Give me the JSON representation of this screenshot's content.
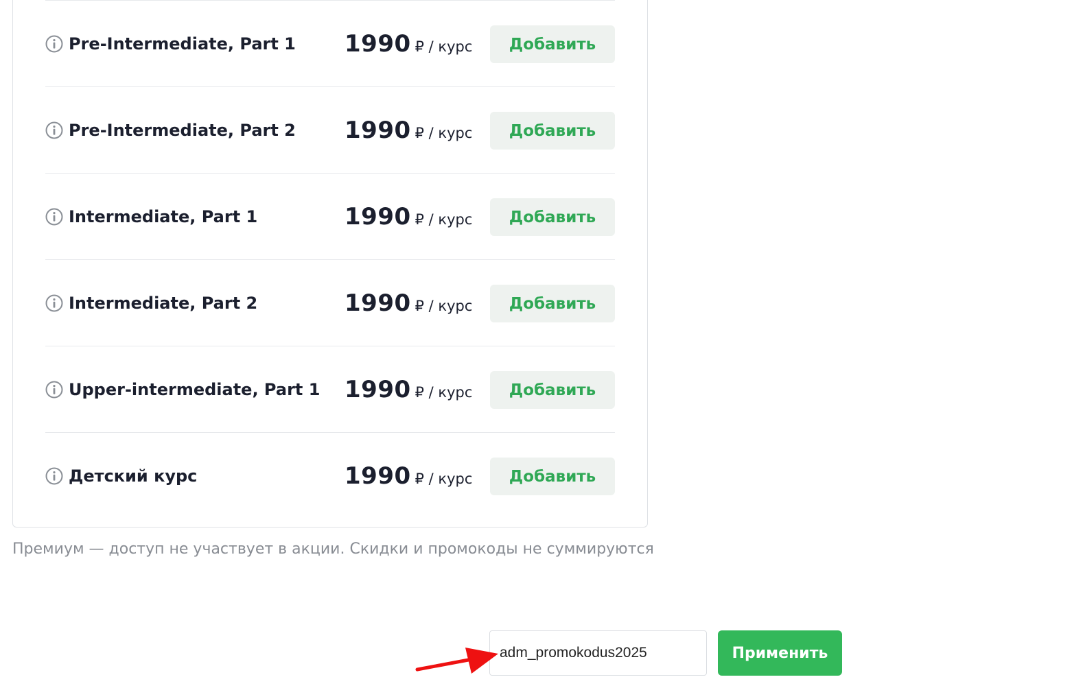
{
  "courses": [
    {
      "name": "Pre-Intermediate, Part 1",
      "price": "1990",
      "unit": "₽ / курс",
      "button": "Добавить"
    },
    {
      "name": "Pre-Intermediate, Part 2",
      "price": "1990",
      "unit": "₽ / курс",
      "button": "Добавить"
    },
    {
      "name": "Intermediate, Part 1",
      "price": "1990",
      "unit": "₽ / курс",
      "button": "Добавить"
    },
    {
      "name": "Intermediate, Part 2",
      "price": "1990",
      "unit": "₽ / курс",
      "button": "Добавить"
    },
    {
      "name": "Upper-intermediate, Part 1",
      "price": "1990",
      "unit": "₽ / курс",
      "button": "Добавить"
    },
    {
      "name": "Детский курс",
      "price": "1990",
      "unit": "₽ / курс",
      "button": "Добавить"
    }
  ],
  "disclaimer": "Премиум  — доступ не участвует в акции. Скидки и промокоды не суммируются",
  "promo": {
    "value": "adm_promokodus2025",
    "apply_label": "Применить"
  },
  "icons": {
    "info": "info-circle-icon",
    "annotation": "red-arrow-icon"
  },
  "colors": {
    "accent_green": "#33b85a",
    "add_button_bg": "#eef2ef",
    "add_button_text": "#2fa855",
    "arrow": "#ee1111"
  }
}
